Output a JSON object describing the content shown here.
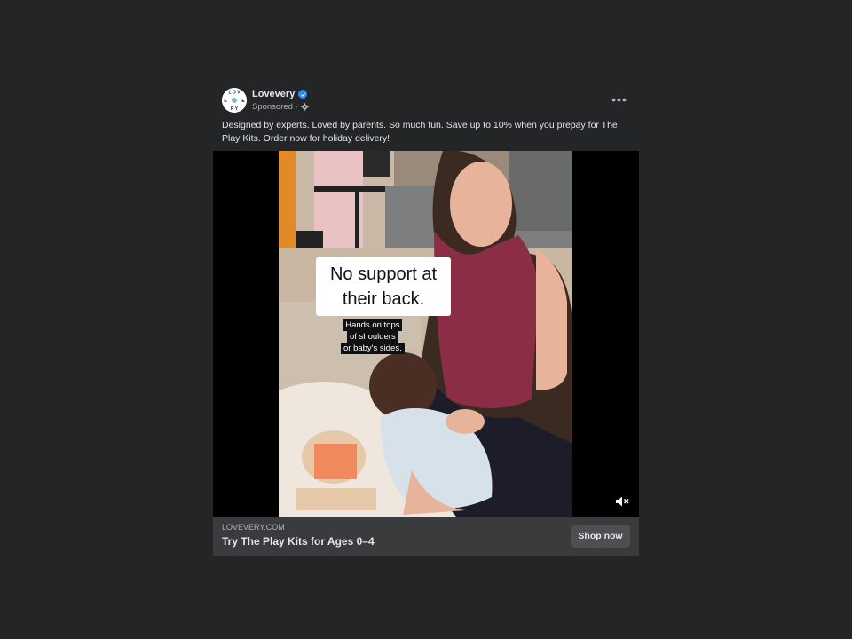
{
  "post": {
    "page_name": "Lovevery",
    "sponsored_label": "Sponsored ·",
    "more_label": "•••",
    "caption": "Designed by experts. Loved by parents. So much fun. Save up to 10% when you prepay for The Play Kits. Order now for holiday delivery!",
    "avatar_text": "LOVEVERY"
  },
  "video": {
    "overlay_title": "No support at their back.",
    "overlay_sub": [
      "Hands on tops",
      "of shoulders",
      "or baby's sides."
    ]
  },
  "cta": {
    "domain": "LOVEVERY.COM",
    "title": "Try The Play Kits for Ages 0–4",
    "button_label": "Shop now"
  },
  "colors": {
    "background": "#242526",
    "verified": "#2d88ff",
    "cta_bar": "#3a3b3c",
    "button": "#4e4f50"
  },
  "icons": [
    "verified-badge-icon",
    "gear-icon",
    "more-icon",
    "mute-icon"
  ]
}
